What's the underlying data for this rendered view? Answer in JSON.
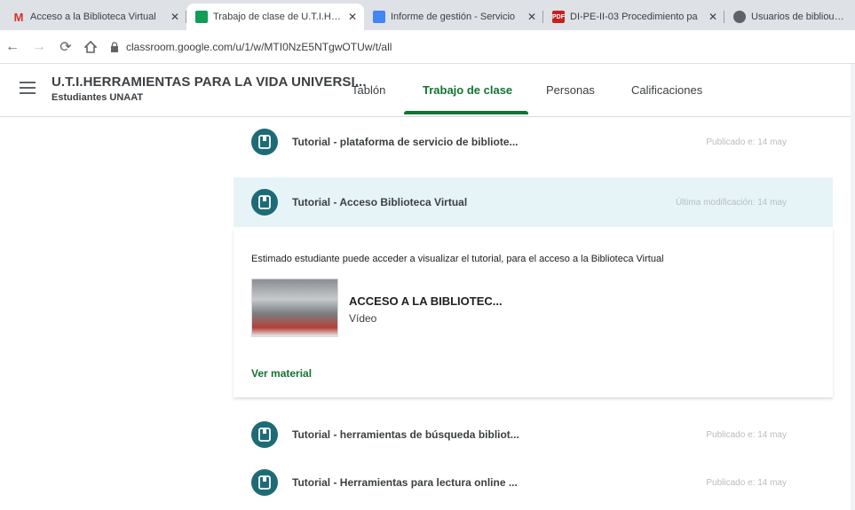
{
  "browser": {
    "tabs": [
      {
        "title": "Acceso a la Biblioteca Virtual",
        "icon": "gmail-icon",
        "color": "#d93025",
        "active": false
      },
      {
        "title": "Trabajo de clase de U.T.I.HERR",
        "icon": "classroom-icon",
        "color": "#0f9d58",
        "active": true
      },
      {
        "title": "Informe de gestión - Servicio",
        "icon": "docs-icon",
        "color": "#4285f4",
        "active": false
      },
      {
        "title": "DI-PE-II-03 Procedimiento pa",
        "icon": "pdf-icon",
        "color": "#c5221f",
        "active": false
      },
      {
        "title": "Usuarios de bibliounaat",
        "icon": "globe-icon",
        "color": "#5f6368",
        "active": false
      }
    ],
    "close_glyph": "✕",
    "url": "classroom.google.com/u/1/w/MTI0NzE5NTgwOTUw/t/all"
  },
  "header": {
    "course_title": "U.T.I.HERRAMIENTAS PARA LA VIDA UNIVERSI...",
    "course_subtitle": "Estudiantes UNAAT",
    "nav": {
      "stream": "Tablón",
      "classwork": "Trabajo de clase",
      "people": "Personas",
      "grades": "Calificaciones"
    },
    "active_tab": "classwork"
  },
  "items": [
    {
      "title": "Tutorial - plataforma de servicio de bibliote...",
      "meta": "Publicado e: 14 may"
    },
    {
      "title": "Tutorial - Acceso Biblioteca Virtual",
      "meta": "Última modificación: 14 may"
    },
    {
      "title": "Tutorial - herramientas de búsqueda bibliot...",
      "meta": "Publicado e: 14 may"
    },
    {
      "title": "Tutorial - Herramientas para lectura online ...",
      "meta": "Publicado e: 14 may"
    }
  ],
  "expanded": {
    "description": "Estimado estudiante puede acceder a visualizar el tutorial, para el acceso a la Biblioteca Virtual",
    "attachment_title": "ACCESO A LA BIBLIOTEC...",
    "attachment_type": "Vídeo",
    "view_link": "Ver material"
  },
  "colors": {
    "accent": "#137333",
    "material_icon": "#1e6b78",
    "highlight_row": "#e6f4f8"
  }
}
